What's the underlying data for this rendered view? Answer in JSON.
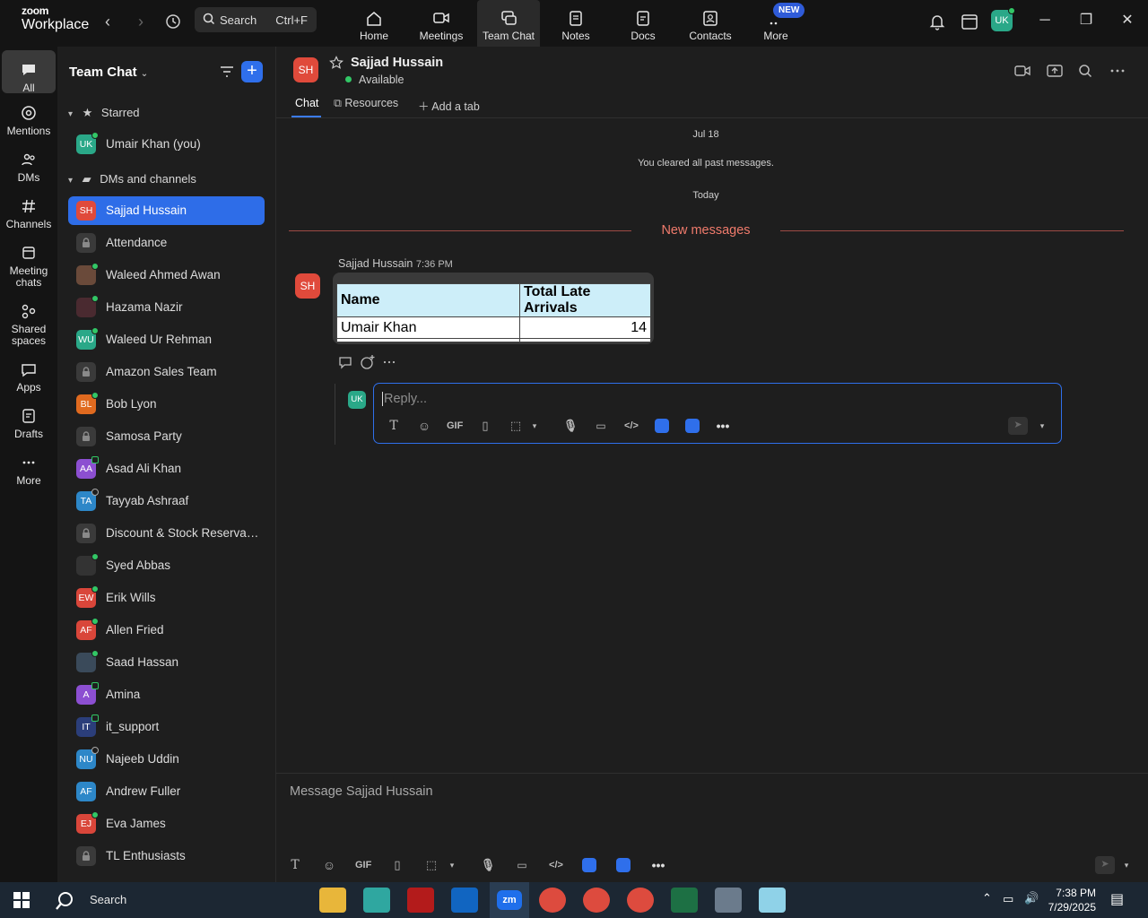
{
  "app": {
    "logo_line1": "zoom",
    "logo_line2": "Workplace"
  },
  "search": {
    "label": "Search",
    "shortcut": "Ctrl+F"
  },
  "nav": [
    {
      "label": "Home",
      "icon": "home-icon"
    },
    {
      "label": "Meetings",
      "icon": "video-icon"
    },
    {
      "label": "Team Chat",
      "icon": "chat-icon",
      "active": true
    },
    {
      "label": "Notes",
      "icon": "notes-icon"
    },
    {
      "label": "Docs",
      "icon": "docs-icon"
    },
    {
      "label": "Contacts",
      "icon": "contacts-icon"
    },
    {
      "label": "More",
      "icon": "more-icon",
      "badge": "NEW"
    }
  ],
  "user": {
    "initials": "UK",
    "color": "#2aa888"
  },
  "rail": [
    {
      "label": "All",
      "icon": "chat-bubble-icon",
      "active": true
    },
    {
      "label": "Mentions",
      "icon": "at-icon"
    },
    {
      "label": "DMs",
      "icon": "people-icon"
    },
    {
      "label": "Channels",
      "icon": "hash-icon"
    },
    {
      "label": "Meeting chats",
      "icon": "calendar-icon"
    },
    {
      "label": "Shared spaces",
      "icon": "shared-icon"
    },
    {
      "label": "Apps",
      "icon": "apps-icon"
    },
    {
      "label": "Drafts",
      "icon": "drafts-icon"
    },
    {
      "label": "More",
      "icon": "ellipsis-icon"
    }
  ],
  "sidebar": {
    "title": "Team Chat",
    "starred_label": "Starred",
    "dms_label": "DMs and channels",
    "starred": [
      {
        "name": "Umair Khan (you)",
        "initials": "UK",
        "color": "#2aa888",
        "presence": "online"
      }
    ],
    "items": [
      {
        "name": "Sajjad Hussain",
        "initials": "SH",
        "color": "#e04a3b",
        "selected": true
      },
      {
        "name": "Attendance",
        "type": "channel"
      },
      {
        "name": "Waleed Ahmed Awan",
        "initials": "",
        "color": "#6a4a3a",
        "presence": "online"
      },
      {
        "name": "Hazama Nazir",
        "initials": "",
        "color": "#4a2a30",
        "presence": "online"
      },
      {
        "name": "Waleed Ur Rehman",
        "initials": "WU",
        "color": "#2aa888",
        "presence": "online"
      },
      {
        "name": "Amazon Sales Team",
        "type": "channel"
      },
      {
        "name": "Bob Lyon",
        "initials": "BL",
        "color": "#e06a1f",
        "presence": "online"
      },
      {
        "name": "Samosa Party",
        "type": "channel"
      },
      {
        "name": "Asad Ali Khan",
        "initials": "AA",
        "color": "#8c4fd1",
        "presence": "mobile"
      },
      {
        "name": "Tayyab Ashraaf",
        "initials": "TA",
        "color": "#2d87c8",
        "presence": "away"
      },
      {
        "name": "Discount & Stock Reservati...",
        "type": "channel"
      },
      {
        "name": "Syed Abbas",
        "initials": "",
        "color": "#333",
        "presence": "online"
      },
      {
        "name": "Erik Wills",
        "initials": "EW",
        "color": "#d9463a",
        "presence": "online"
      },
      {
        "name": "Allen Fried",
        "initials": "AF",
        "color": "#d9463a",
        "presence": "online"
      },
      {
        "name": "Saad Hassan",
        "initials": "",
        "color": "#3a4a5a",
        "presence": "online"
      },
      {
        "name": "Amina",
        "initials": "A",
        "color": "#8c4fd1",
        "presence": "mobile"
      },
      {
        "name": "it_support",
        "initials": "IT",
        "color": "#2b3e7a",
        "presence": "mobile"
      },
      {
        "name": "Najeeb Uddin",
        "initials": "NU",
        "color": "#2d87c8",
        "presence": "away"
      },
      {
        "name": "Andrew Fuller",
        "initials": "AF",
        "color": "#2d87c8",
        "presence": "none"
      },
      {
        "name": "Eva James",
        "initials": "EJ",
        "color": "#d9463a",
        "presence": "online"
      },
      {
        "name": "TL Enthusiasts",
        "type": "channel"
      }
    ]
  },
  "chat": {
    "contact_name": "Sajjad Hussain",
    "contact_initials": "SH",
    "status": "Available",
    "tabs": [
      "Chat",
      "Resources",
      "Add a tab"
    ],
    "date1": "Jul 18",
    "cleared": "You cleared all past messages.",
    "date2": "Today",
    "new_messages": "New messages",
    "message": {
      "sender": "Sajjad Hussain",
      "time": "7:36 PM",
      "table_headers": [
        "Name",
        "Total Late Arrivals"
      ],
      "table_rows": [
        [
          "Umair Khan",
          "14"
        ]
      ]
    },
    "reply_initials": "UK",
    "reply_placeholder": "Reply...",
    "composer_placeholder": "Message Sajjad Hussain"
  },
  "taskbar": {
    "search": "Search",
    "time": "7:38 PM",
    "date": "7/29/2025"
  },
  "colors": {
    "accent": "#2f6feb",
    "online": "#32c766",
    "new_messages": "#f07b6c"
  }
}
